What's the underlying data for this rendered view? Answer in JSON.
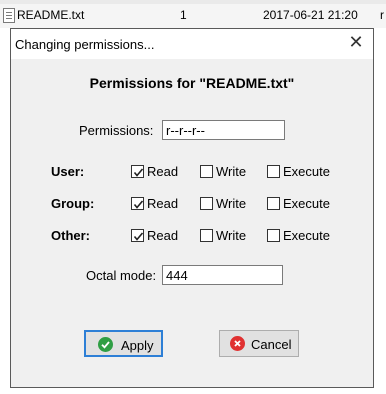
{
  "background_row": {
    "file_name": "README.txt",
    "count": "1",
    "date": "2017-06-21 21:20",
    "extra": "r"
  },
  "dialog": {
    "title": "Changing permissions...",
    "close_glyph": "✕",
    "heading": "Permissions for \"README.txt\"",
    "permissions_label": "Permissions:",
    "permissions_value": "r--r--r--",
    "octal_label": "Octal mode:",
    "octal_value": "444",
    "columns": {
      "read": "Read",
      "write": "Write",
      "execute": "Execute"
    },
    "rows": [
      {
        "label": "User:",
        "read": true,
        "write": false,
        "execute": false
      },
      {
        "label": "Group:",
        "read": true,
        "write": false,
        "execute": false
      },
      {
        "label": "Other:",
        "read": true,
        "write": false,
        "execute": false
      }
    ],
    "apply_label": "Apply",
    "cancel_label": "Cancel"
  },
  "colors": {
    "apply_icon": "#2f9e44",
    "cancel_icon": "#e03131",
    "default_border": "#2d7fd6"
  },
  "icons": {
    "apply": "check-circle-icon",
    "cancel": "x-circle-icon",
    "close": "close-icon",
    "file": "file-icon"
  }
}
